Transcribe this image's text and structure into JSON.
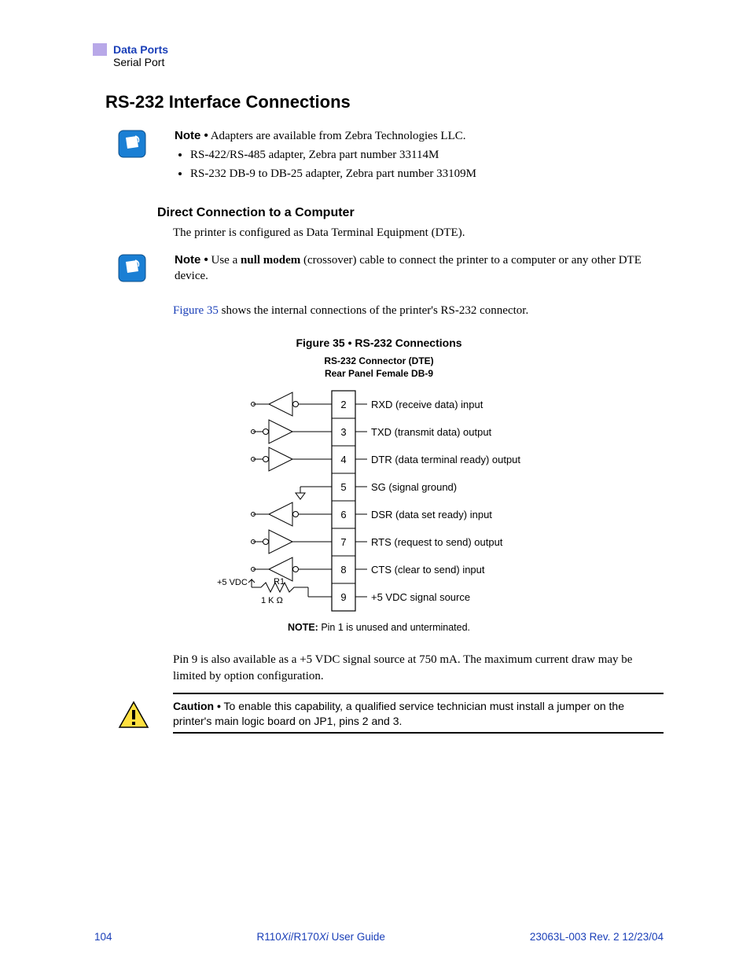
{
  "header": {
    "section": "Data Ports",
    "subsection": "Serial Port"
  },
  "heading": "RS-232 Interface Connections",
  "note1": {
    "label": "Note •",
    "text": " Adapters are available from Zebra Technologies LLC.",
    "bullets": [
      "RS-422/RS-485 adapter, Zebra part number 33114M",
      "RS-232 DB-9 to DB-25 adapter, Zebra part number 33109M"
    ]
  },
  "sub1": {
    "heading": "Direct Connection to a Computer",
    "para": "The printer is configured as Data Terminal Equipment (DTE)."
  },
  "note2": {
    "label": "Note •",
    "pre": " Use a ",
    "bold": "null modem",
    "post": " (crossover) cable to connect the printer to a computer or any other DTE device."
  },
  "figref": {
    "link": "Figure 35",
    "rest": " shows the internal connections of the printer's RS-232 connector."
  },
  "figure": {
    "caption": "Figure 35 • RS-232 Connections",
    "sub1": "RS-232 Connector (DTE)",
    "sub2": "Rear Panel Female DB-9",
    "pins": [
      {
        "num": "2",
        "label": "RXD (receive data) input"
      },
      {
        "num": "3",
        "label": "TXD (transmit data) output"
      },
      {
        "num": "4",
        "label": "DTR (data terminal ready) output"
      },
      {
        "num": "5",
        "label": "SG (signal ground)"
      },
      {
        "num": "6",
        "label": "DSR (data set ready) input"
      },
      {
        "num": "7",
        "label": "RTS (request to send) output"
      },
      {
        "num": "8",
        "label": "CTS (clear to send) input"
      },
      {
        "num": "9",
        "label": "+5 VDC signal source"
      }
    ],
    "vdc": "+5 VDC",
    "r1": "R1",
    "r1val": "1 K Ω",
    "noteLabel": "NOTE:",
    "noteText": "  Pin 1 is unused and unterminated."
  },
  "para2": "Pin 9 is also available as a +5 VDC signal source at 750 mA. The maximum current draw may be limited by option configuration.",
  "caution": {
    "label": "Caution •",
    "text": " To enable this capability, a qualified service technician must install a jumper on the printer's main logic board on JP1, pins 2 and 3."
  },
  "footer": {
    "left": "104",
    "centerA": "R110",
    "centerI1": "Xi",
    "centerB": "/R170",
    "centerI2": "Xi",
    "centerC": " User Guide",
    "right": "23063L-003 Rev. 2   12/23/04"
  }
}
